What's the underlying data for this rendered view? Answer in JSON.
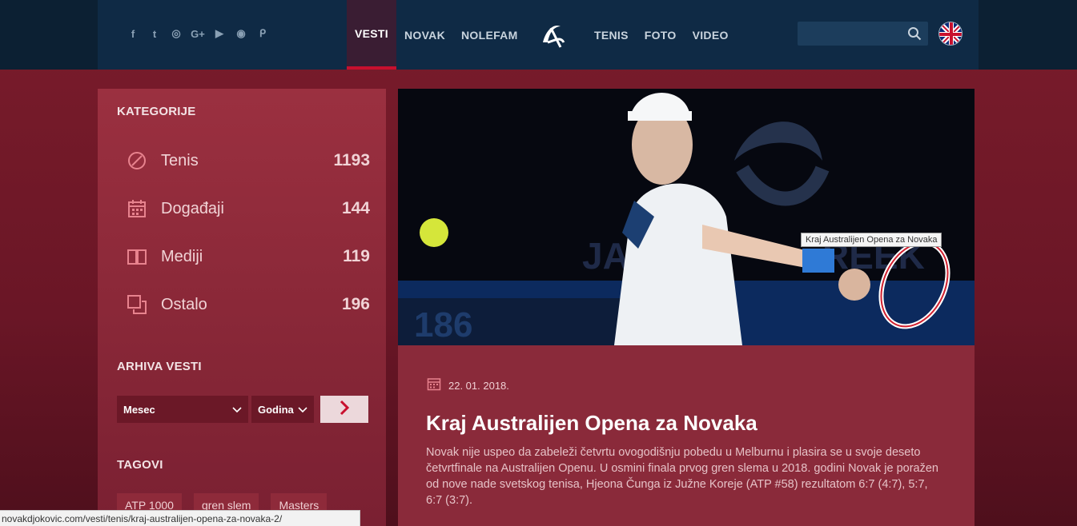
{
  "header": {
    "social_icons": [
      "facebook-icon",
      "twitter-icon",
      "instagram-icon",
      "google-plus-icon",
      "youtube-icon",
      "weibo-icon",
      "periscope-icon"
    ],
    "social_glyphs": [
      "f",
      "t",
      "◎",
      "G+",
      "▶",
      "◉",
      "ᑭ"
    ],
    "nav_left": [
      {
        "label": "VESTI",
        "active": true
      },
      {
        "label": "NOVAK",
        "active": false
      },
      {
        "label": "NOLEFAM",
        "active": false
      }
    ],
    "nav_right": [
      {
        "label": "TENIS",
        "active": false
      },
      {
        "label": "FOTO",
        "active": false
      },
      {
        "label": "VIDEO",
        "active": false
      }
    ],
    "search_placeholder": "",
    "language": "UK flag"
  },
  "sidebar": {
    "categories_title": "KATEGORIJE",
    "categories": [
      {
        "label": "Tenis",
        "count": "1193",
        "icon": "tennis-ball-icon"
      },
      {
        "label": "Događaji",
        "count": "144",
        "icon": "calendar-icon"
      },
      {
        "label": "Mediji",
        "count": "119",
        "icon": "book-icon"
      },
      {
        "label": "Ostalo",
        "count": "196",
        "icon": "copy-icon"
      }
    ],
    "archive_title": "ARHIVA VESTI",
    "month_select": "Mesec",
    "year_select": "Godina",
    "tags_title": "TAGOVI",
    "tags": [
      "ATP 1000",
      "gren slem",
      "Masters"
    ]
  },
  "article": {
    "image_tooltip": "Kraj Australijen Opena za Novaka",
    "date": "22. 01. 2018.",
    "title": "Kraj Australijen Opena za Novaka",
    "excerpt": "Novak nije uspeo da zabeleži četvrtu ovogodišnju pobedu u Melburnu i plasira se u svoje deseto četvrtfinale na Australijen Openu. U osmini finala prvog gren slema u 2018. godini Novak je poražen od nove nade svetskog tenisa, Hjeona Čunga iz Južne Koreje (ATP #58) rezultatom 6:7 (4:7), 5:7, 6:7 (3:7)."
  },
  "statusbar": {
    "url": "novakdjokovic.com/vesti/tenis/kraj-australijen-opena-za-novaka-2/"
  },
  "colors": {
    "topbar": "#0f2a45",
    "accent_red": "#c8102e",
    "sidebar": "#9b3040"
  }
}
